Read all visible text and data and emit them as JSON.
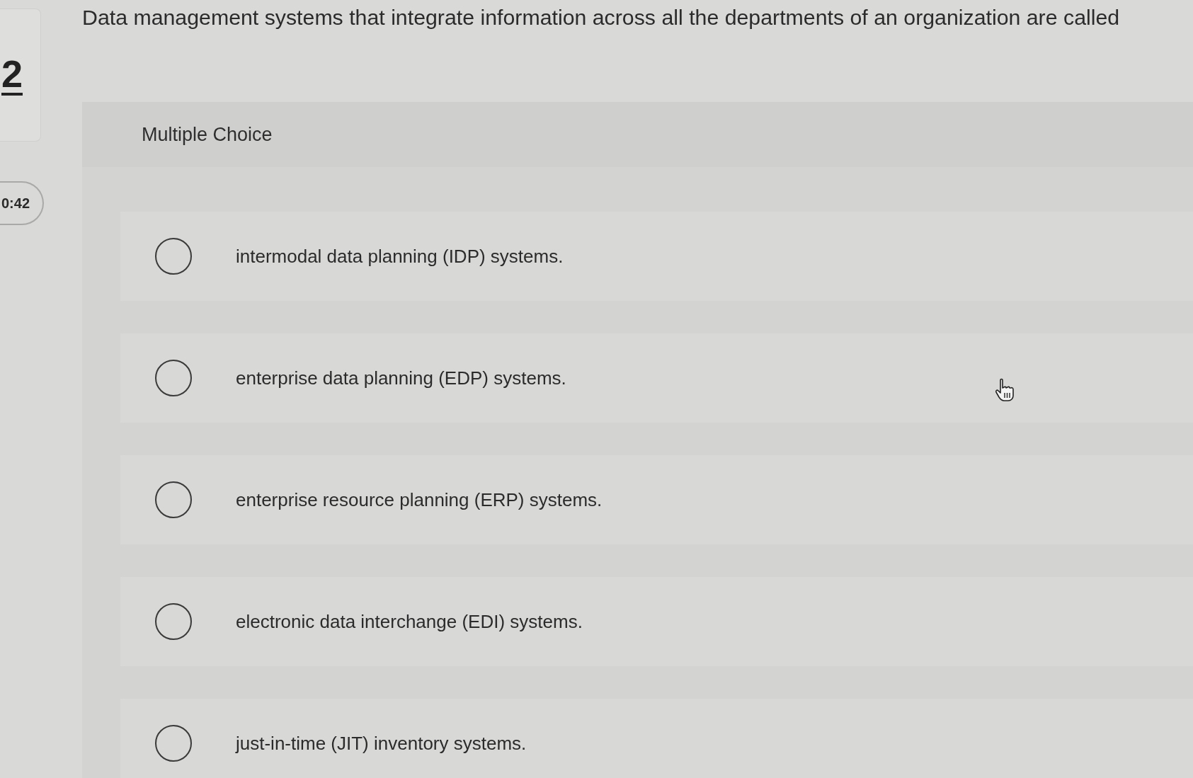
{
  "question_number": "2",
  "timer": "0:42",
  "question": "Data management systems that integrate information across all the departments of an organization are called",
  "panel": {
    "title": "Multiple Choice",
    "options": [
      {
        "label": "intermodal data planning (IDP) systems.",
        "selected": false
      },
      {
        "label": "enterprise data planning (EDP) systems.",
        "selected": false
      },
      {
        "label": "enterprise resource planning (ERP) systems.",
        "selected": false
      },
      {
        "label": "electronic data interchange (EDI) systems.",
        "selected": false
      },
      {
        "label": "just-in-time (JIT) inventory systems.",
        "selected": false
      }
    ]
  }
}
